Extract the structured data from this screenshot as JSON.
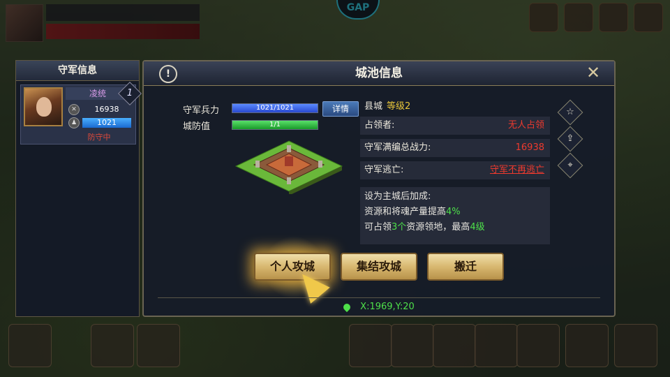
{
  "top": {
    "logo": "GAP",
    "info_text": "",
    "red_text": ""
  },
  "left_panel": {
    "title": "守军信息",
    "general": {
      "name": "凌统",
      "level": "1",
      "power": "16938",
      "troops": "1021",
      "status": "防守中",
      "power_icon": "crossed-swords-icon",
      "troops_icon": "soldier-icon"
    }
  },
  "dialog": {
    "title": "城池信息",
    "garrison_label": "守军兵力",
    "garrison_value": "1021/1021",
    "garrison_fill": 1.0,
    "defense_label": "城防值",
    "defense_value": "1/1",
    "defense_fill": 1.0,
    "detail_button": "详情",
    "city_type": "县城",
    "city_level": "等级2",
    "rows": [
      {
        "key": "占领者:",
        "value": "无人占领",
        "underline": false
      },
      {
        "key": "守军满编总战力:",
        "value": "16938",
        "underline": false
      },
      {
        "key": "守军逃亡:",
        "value": "守军不再逃亡",
        "underline": true
      }
    ],
    "bonus": {
      "title": "设为主城后加成:",
      "line1_a": "资源和将魂产量提高",
      "line1_b": "4%",
      "line2_a": "可占领",
      "line2_b": "3个",
      "line2_c": "资源领地，最高",
      "line2_d": "4级"
    },
    "buttons": {
      "attack": "个人攻城",
      "rally": "集结攻城",
      "move": "搬迁"
    },
    "coordinates": "X:1969,Y:20"
  },
  "colors": {
    "accent_gold": "#c8a050",
    "red": "#ee3a2e",
    "green": "#4ee04a",
    "level_yellow": "#e8c63a"
  }
}
